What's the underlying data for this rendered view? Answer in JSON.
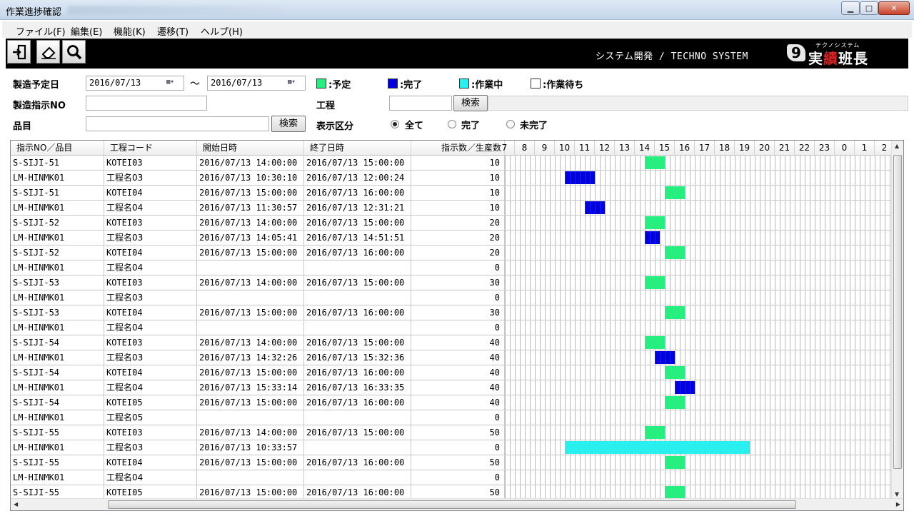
{
  "window": {
    "title": "作業進捗確認"
  },
  "menu": [
    {
      "label": "ファイル(F)",
      "x": 0
    },
    {
      "label": "編集(E)"
    },
    {
      "label": "機能(K)"
    },
    {
      "label": "遷移(T)"
    },
    {
      "label": "ヘルプ(H)"
    }
  ],
  "toolbar": {
    "company": "システム開発 / TECHNO SYSTEM",
    "logo_kana": "テクノシステム",
    "logo_word_a": "実",
    "logo_word_b": "績",
    "logo_word_c": "班長",
    "logo_mark": "9"
  },
  "filters": {
    "date_label": "製造予定日",
    "date_from": "2016/07/13",
    "date_to": "2016/07/13",
    "tilde": "～",
    "order_label": "製造指示NO",
    "order_value": "",
    "item_label": "品目",
    "item_value": "",
    "search_button": "検索",
    "process_label": "工程",
    "process_value": "",
    "process_search_button": "検索",
    "display_label": "表示区分",
    "radios": [
      {
        "label": "全て",
        "selected": true
      },
      {
        "label": "完了",
        "selected": false
      },
      {
        "label": "未完了",
        "selected": false
      }
    ]
  },
  "legend": [
    {
      "label": ":予定",
      "color": "#26ee7f"
    },
    {
      "label": ":完了",
      "color": "#0000dd"
    },
    {
      "label": ":作業中",
      "color": "#2aefef"
    },
    {
      "label": ":作業待ち",
      "color": "#ffffff"
    }
  ],
  "table": {
    "headers": [
      "指示NO／品目",
      "工程コード",
      "開始日時",
      "終了日時",
      "指示数／生産数"
    ],
    "hours": [
      "7",
      "8",
      "9",
      "10",
      "11",
      "12",
      "13",
      "14",
      "15",
      "16",
      "17",
      "18",
      "19",
      "20",
      "21",
      "22",
      "23",
      "0",
      "1",
      "2"
    ],
    "rows": [
      {
        "no": "S-SIJI-51",
        "proc": "KOTEI03",
        "start": "2016/07/13 14:00:00",
        "end": "2016/07/13 15:00:00",
        "qty": "10",
        "status": "plan",
        "from": 14.0,
        "to": 15.0
      },
      {
        "no": "LM-HINMK01",
        "proc": "工程名03",
        "start": "2016/07/13 10:30:10",
        "end": "2016/07/13 12:00:24",
        "qty": "10",
        "status": "done",
        "from": 10.0,
        "to": 11.5
      },
      {
        "no": "S-SIJI-51",
        "proc": "KOTEI04",
        "start": "2016/07/13 15:00:00",
        "end": "2016/07/13 16:00:00",
        "qty": "10",
        "status": "plan",
        "from": 15.0,
        "to": 16.0
      },
      {
        "no": "LM-HINMK01",
        "proc": "工程名04",
        "start": "2016/07/13 11:30:57",
        "end": "2016/07/13 12:31:21",
        "qty": "10",
        "status": "done",
        "from": 11.0,
        "to": 12.0
      },
      {
        "no": "S-SIJI-52",
        "proc": "KOTEI03",
        "start": "2016/07/13 14:00:00",
        "end": "2016/07/13 15:00:00",
        "qty": "20",
        "status": "plan",
        "from": 14.0,
        "to": 15.0
      },
      {
        "no": "LM-HINMK01",
        "proc": "工程名03",
        "start": "2016/07/13 14:05:41",
        "end": "2016/07/13 14:51:51",
        "qty": "20",
        "status": "done",
        "from": 14.0,
        "to": 14.75
      },
      {
        "no": "S-SIJI-52",
        "proc": "KOTEI04",
        "start": "2016/07/13 15:00:00",
        "end": "2016/07/13 16:00:00",
        "qty": "20",
        "status": "plan",
        "from": 15.0,
        "to": 16.0
      },
      {
        "no": "LM-HINMK01",
        "proc": "工程名04",
        "start": "",
        "end": "",
        "qty": "0",
        "status": "none"
      },
      {
        "no": "S-SIJI-53",
        "proc": "KOTEI03",
        "start": "2016/07/13 14:00:00",
        "end": "2016/07/13 15:00:00",
        "qty": "30",
        "status": "plan",
        "from": 14.0,
        "to": 15.0
      },
      {
        "no": "LM-HINMK01",
        "proc": "工程名03",
        "start": "",
        "end": "",
        "qty": "0",
        "status": "none"
      },
      {
        "no": "S-SIJI-53",
        "proc": "KOTEI04",
        "start": "2016/07/13 15:00:00",
        "end": "2016/07/13 16:00:00",
        "qty": "30",
        "status": "plan",
        "from": 15.0,
        "to": 16.0
      },
      {
        "no": "LM-HINMK01",
        "proc": "工程名04",
        "start": "",
        "end": "",
        "qty": "0",
        "status": "none"
      },
      {
        "no": "S-SIJI-54",
        "proc": "KOTEI03",
        "start": "2016/07/13 14:00:00",
        "end": "2016/07/13 15:00:00",
        "qty": "40",
        "status": "plan",
        "from": 14.0,
        "to": 15.0
      },
      {
        "no": "LM-HINMK01",
        "proc": "工程名03",
        "start": "2016/07/13 14:32:26",
        "end": "2016/07/13 15:32:36",
        "qty": "40",
        "status": "done",
        "from": 14.5,
        "to": 15.5
      },
      {
        "no": "S-SIJI-54",
        "proc": "KOTEI04",
        "start": "2016/07/13 15:00:00",
        "end": "2016/07/13 16:00:00",
        "qty": "40",
        "status": "plan",
        "from": 15.0,
        "to": 16.0
      },
      {
        "no": "LM-HINMK01",
        "proc": "工程名04",
        "start": "2016/07/13 15:33:14",
        "end": "2016/07/13 16:33:35",
        "qty": "40",
        "status": "done",
        "from": 15.5,
        "to": 16.5
      },
      {
        "no": "S-SIJI-54",
        "proc": "KOTEI05",
        "start": "2016/07/13 15:00:00",
        "end": "2016/07/13 16:00:00",
        "qty": "40",
        "status": "plan",
        "from": 15.0,
        "to": 16.0
      },
      {
        "no": "LM-HINMK01",
        "proc": "工程名05",
        "start": "",
        "end": "",
        "qty": "0",
        "status": "none"
      },
      {
        "no": "S-SIJI-55",
        "proc": "KOTEI03",
        "start": "2016/07/13 14:00:00",
        "end": "2016/07/13 15:00:00",
        "qty": "50",
        "status": "plan",
        "from": 14.0,
        "to": 15.0
      },
      {
        "no": "LM-HINMK01",
        "proc": "工程名03",
        "start": "2016/07/13 10:33:57",
        "end": "",
        "qty": "0",
        "status": "working",
        "from": 10.0,
        "to": 19.25
      },
      {
        "no": "S-SIJI-55",
        "proc": "KOTEI04",
        "start": "2016/07/13 15:00:00",
        "end": "2016/07/13 16:00:00",
        "qty": "50",
        "status": "plan",
        "from": 15.0,
        "to": 16.0
      },
      {
        "no": "LM-HINMK01",
        "proc": "工程名04",
        "start": "",
        "end": "",
        "qty": "0",
        "status": "none"
      },
      {
        "no": "S-SIJI-55",
        "proc": "KOTEI05",
        "start": "2016/07/13 15:00:00",
        "end": "2016/07/13 16:00:00",
        "qty": "50",
        "status": "plan",
        "from": 15.0,
        "to": 16.0
      }
    ]
  }
}
